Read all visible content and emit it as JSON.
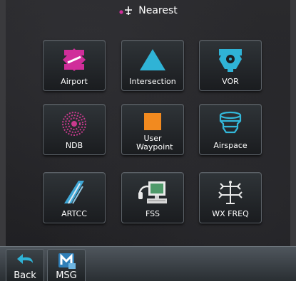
{
  "header": {
    "title": "Nearest",
    "icon": "nearest-icon"
  },
  "tiles": [
    {
      "label": "Airport",
      "icon": "airport-icon",
      "color": "#d02e9a"
    },
    {
      "label": "Intersection",
      "icon": "intersection-icon",
      "color": "#2fb3d6"
    },
    {
      "label": "VOR",
      "icon": "vor-icon",
      "color": "#2fb3d6"
    },
    {
      "label": "NDB",
      "icon": "ndb-icon",
      "color": "#c93a8e"
    },
    {
      "label": "User Waypoint",
      "icon": "user-waypoint-icon",
      "color": "#f28a1f"
    },
    {
      "label": "Airspace",
      "icon": "airspace-icon",
      "color": "#33b8da"
    },
    {
      "label": "ARTCC",
      "icon": "artcc-icon",
      "color": "#3fa7d6"
    },
    {
      "label": "FSS",
      "icon": "fss-icon",
      "color": "#eaeaea"
    },
    {
      "label": "WX FREQ",
      "icon": "wx-freq-icon",
      "color": "#eaeaea"
    }
  ],
  "softkeys": {
    "back": {
      "label": "Back",
      "icon": "back-arrow-icon"
    },
    "msg": {
      "label": "MSG",
      "icon": "msg-icon"
    }
  },
  "colors": {
    "accent_cyan": "#2fb3d6",
    "accent_magenta": "#d02e9a",
    "accent_orange": "#f28a1f"
  }
}
